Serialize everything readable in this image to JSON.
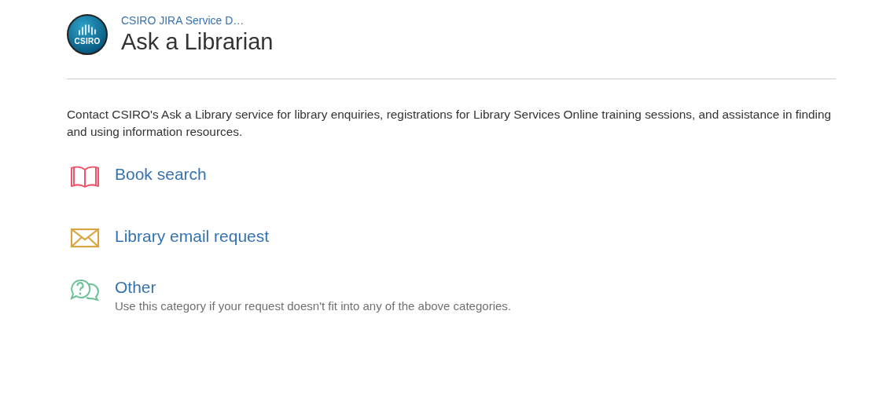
{
  "header": {
    "logo_text": "CSIRO",
    "breadcrumb": "CSIRO JIRA Service D…",
    "title": "Ask a Librarian"
  },
  "description": "Contact CSIRO's Ask a Library service for library enquiries, registrations for Library Services Online training sessions, and assistance in finding and using information resources.",
  "request_types": [
    {
      "kind": "book",
      "label": "Book search"
    },
    {
      "kind": "envelope",
      "label": "Library email request"
    },
    {
      "kind": "question",
      "label": "Other",
      "description": "Use this category if your request doesn't fit into any of the above categories."
    }
  ]
}
